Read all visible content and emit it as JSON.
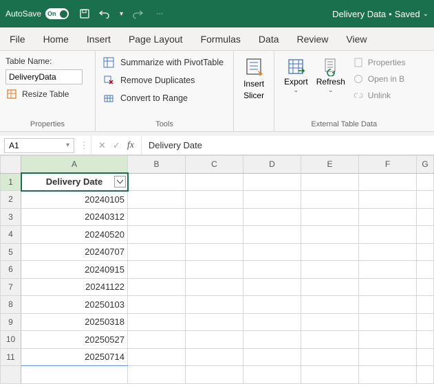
{
  "titlebar": {
    "autosave_label": "AutoSave",
    "toggle_text": "On",
    "doc_name": "Delivery Data",
    "saved_text": "Saved"
  },
  "tabs": [
    "File",
    "Home",
    "Insert",
    "Page Layout",
    "Formulas",
    "Data",
    "Review",
    "View"
  ],
  "ribbon": {
    "properties": {
      "table_name_label": "Table Name:",
      "table_name_value": "DeliveryData",
      "resize_label": "Resize Table",
      "group_label": "Properties"
    },
    "tools": {
      "summarize": "Summarize with PivotTable",
      "remove_dup": "Remove Duplicates",
      "convert": "Convert to Range",
      "group_label": "Tools"
    },
    "slicer": {
      "insert_label": "Insert",
      "slicer_label": "Slicer"
    },
    "export": "Export",
    "refresh": "Refresh",
    "ext": {
      "properties": "Properties",
      "open": "Open in B",
      "unlink": "Unlink",
      "group_label": "External Table Data"
    }
  },
  "formula_bar": {
    "cell_ref": "A1",
    "value": "Delivery Date"
  },
  "grid": {
    "columns": [
      "A",
      "B",
      "C",
      "D",
      "E",
      "F",
      "G"
    ],
    "header_cell": "Delivery Date",
    "rows": [
      {
        "n": 1,
        "v": ""
      },
      {
        "n": 2,
        "v": "20240105"
      },
      {
        "n": 3,
        "v": "20240312"
      },
      {
        "n": 4,
        "v": "20240520"
      },
      {
        "n": 5,
        "v": "20240707"
      },
      {
        "n": 6,
        "v": "20240915"
      },
      {
        "n": 7,
        "v": "20241122"
      },
      {
        "n": 8,
        "v": "20250103"
      },
      {
        "n": 9,
        "v": "20250318"
      },
      {
        "n": 10,
        "v": "20250527"
      },
      {
        "n": 11,
        "v": "20250714"
      }
    ]
  }
}
